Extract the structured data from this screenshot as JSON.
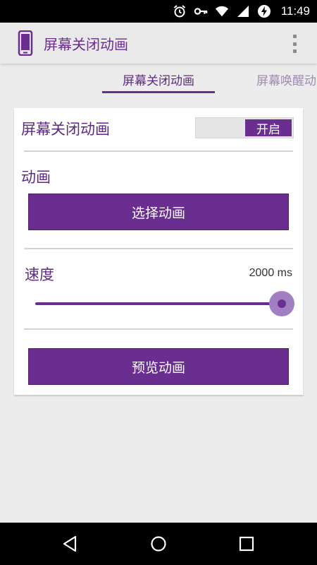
{
  "status_bar": {
    "time": "11:49",
    "icons": [
      "alarm-icon",
      "key-icon",
      "wifi-icon",
      "signal-icon",
      "battery-charging-icon"
    ]
  },
  "action_bar": {
    "title": "屏幕关闭动画",
    "app_icon": "phone-icon",
    "menu_icon": "overflow-menu-icon"
  },
  "tabs": [
    {
      "label": "屏幕关闭动画",
      "active": true
    },
    {
      "label": "屏幕唤醒动画",
      "active": false
    }
  ],
  "settings": {
    "toggle_label": "屏幕关闭动画",
    "toggle_state": "开启",
    "animation_label": "动画",
    "select_button": "选择动画",
    "speed_label": "速度",
    "speed_value": "2000 ms",
    "speed_fraction": 1.0,
    "preview_button": "预览动画"
  },
  "colors": {
    "accent": "#6a2d90",
    "background": "#ececec",
    "card": "#ffffff"
  },
  "nav_bar": {
    "icons": [
      "back-icon",
      "home-icon",
      "recents-icon"
    ]
  }
}
